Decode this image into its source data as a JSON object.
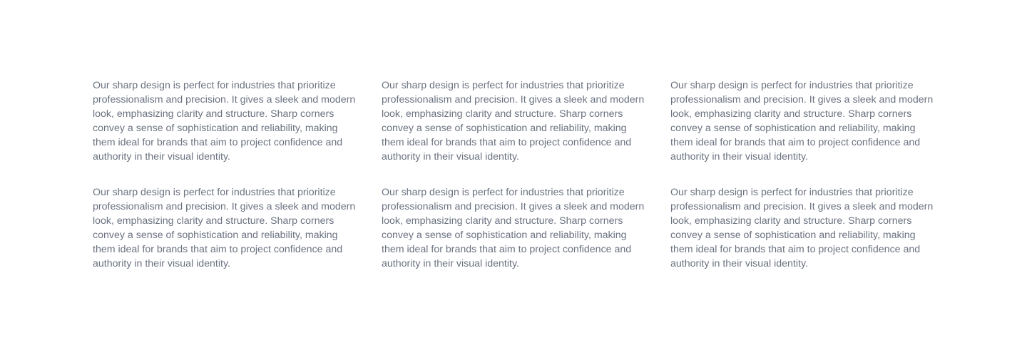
{
  "cards": [
    {
      "text": "Our sharp design is perfect for industries that prioritize professionalism and precision. It gives a sleek and modern look, emphasizing clarity and structure. Sharp corners convey a sense of sophistication and reliability, making them ideal for brands that aim to project confidence and authority in their visual identity."
    },
    {
      "text": "Our sharp design is perfect for industries that prioritize professionalism and precision. It gives a sleek and modern look, emphasizing clarity and structure. Sharp corners convey a sense of sophistication and reliability, making them ideal for brands that aim to project confidence and authority in their visual identity."
    },
    {
      "text": "Our sharp design is perfect for industries that prioritize professionalism and precision. It gives a sleek and modern look, emphasizing clarity and structure. Sharp corners convey a sense of sophistication and reliability, making them ideal for brands that aim to project confidence and authority in their visual identity."
    },
    {
      "text": "Our sharp design is perfect for industries that prioritize professionalism and precision. It gives a sleek and modern look, emphasizing clarity and structure. Sharp corners convey a sense of sophistication and reliability, making them ideal for brands that aim to project confidence and authority in their visual identity."
    },
    {
      "text": "Our sharp design is perfect for industries that prioritize professionalism and precision. It gives a sleek and modern look, emphasizing clarity and structure. Sharp corners convey a sense of sophistication and reliability, making them ideal for brands that aim to project confidence and authority in their visual identity."
    },
    {
      "text": "Our sharp design is perfect for industries that prioritize professionalism and precision. It gives a sleek and modern look, emphasizing clarity and structure. Sharp corners convey a sense of sophistication and reliability, making them ideal for brands that aim to project confidence and authority in their visual identity."
    }
  ],
  "colors": {
    "background": "#ffffff",
    "text": "#6b7280"
  }
}
